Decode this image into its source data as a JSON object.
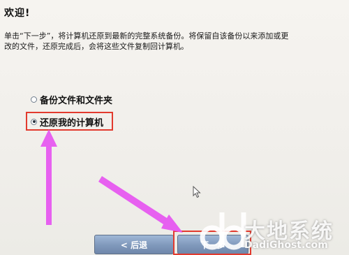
{
  "title": "欢迎!",
  "description": {
    "line1": "单击“下一步”，将计算机还原到最新的完整系统备份。将保留自该备份以来添加或更",
    "line2": "改的文件，还原完成后，会将这些文件复制回计算机。"
  },
  "options": [
    {
      "label": "备份文件和文件夹",
      "selected": false
    },
    {
      "label": "还原我的计算机",
      "selected": true
    }
  ],
  "buttons": {
    "back": "< 后退",
    "next": "下一步"
  },
  "watermark": {
    "brand": "大地系统",
    "url": "DadiGhost.com"
  },
  "colors": {
    "highlight": "#e23a2e",
    "arrow": "#e659f0",
    "button": "#7f98bb"
  }
}
